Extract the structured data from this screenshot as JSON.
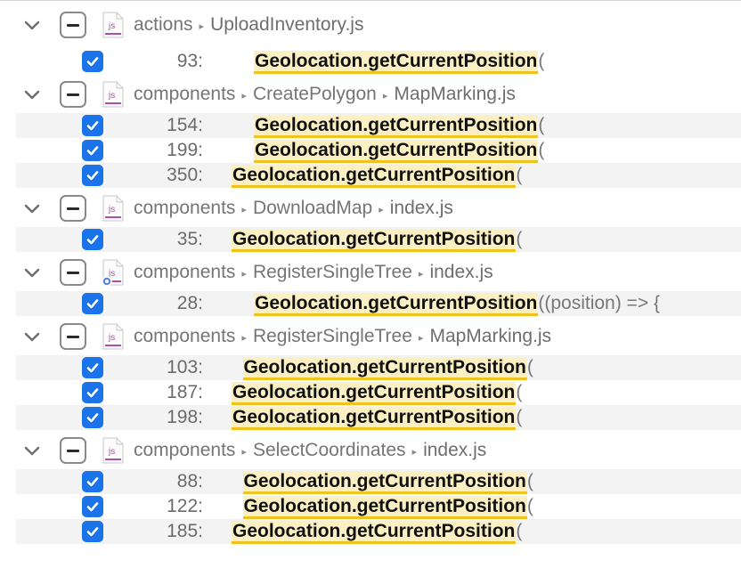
{
  "groups": [
    {
      "path": [
        "actions",
        "UploadInventory.js"
      ],
      "icon": "js-file-icon",
      "matches": [
        {
          "line": "93:",
          "indent": 2,
          "match": "Geolocation.getCurrentPosition",
          "rest": "("
        }
      ]
    },
    {
      "path": [
        "components",
        "CreatePolygon",
        "MapMarking.js"
      ],
      "icon": "js-file-icon",
      "matches": [
        {
          "line": "154:",
          "indent": 2,
          "match": "Geolocation.getCurrentPosition",
          "rest": "("
        },
        {
          "line": "199:",
          "indent": 2,
          "match": "Geolocation.getCurrentPosition",
          "rest": "("
        },
        {
          "line": "350:",
          "indent": 0,
          "match": "Geolocation.getCurrentPosition",
          "rest": "("
        }
      ]
    },
    {
      "path": [
        "components",
        "DownloadMap",
        "index.js"
      ],
      "icon": "js-file-icon",
      "matches": [
        {
          "line": "35:",
          "indent": 0,
          "match": "Geolocation.getCurrentPosition",
          "rest": "("
        }
      ]
    },
    {
      "path": [
        "components",
        "RegisterSingleTree",
        "index.js"
      ],
      "icon": "js-file-modified-icon",
      "matches": [
        {
          "line": "28:",
          "indent": 2,
          "match": "Geolocation.getCurrentPosition",
          "rest": "((position) => {"
        }
      ]
    },
    {
      "path": [
        "components",
        "RegisterSingleTree",
        "MapMarking.js"
      ],
      "icon": "js-file-icon",
      "matches": [
        {
          "line": "103:",
          "indent": 1,
          "match": "Geolocation.getCurrentPosition",
          "rest": "("
        },
        {
          "line": "187:",
          "indent": 0,
          "match": "Geolocation.getCurrentPosition",
          "rest": "("
        },
        {
          "line": "198:",
          "indent": 0,
          "match": "Geolocation.getCurrentPosition",
          "rest": "("
        }
      ]
    },
    {
      "path": [
        "components",
        "SelectCoordinates",
        "index.js"
      ],
      "icon": "js-file-icon",
      "matches": [
        {
          "line": "88:",
          "indent": 1,
          "match": "Geolocation.getCurrentPosition",
          "rest": "("
        },
        {
          "line": "122:",
          "indent": 1,
          "match": "Geolocation.getCurrentPosition",
          "rest": "("
        },
        {
          "line": "185:",
          "indent": 0,
          "match": "Geolocation.getCurrentPosition",
          "rest": "("
        }
      ]
    }
  ],
  "colors": {
    "accent": "#1a73e8",
    "highlight_bg": "#fbf0c4",
    "highlight_underline": "#f0c21c",
    "js_icon": "#b04fa8"
  }
}
